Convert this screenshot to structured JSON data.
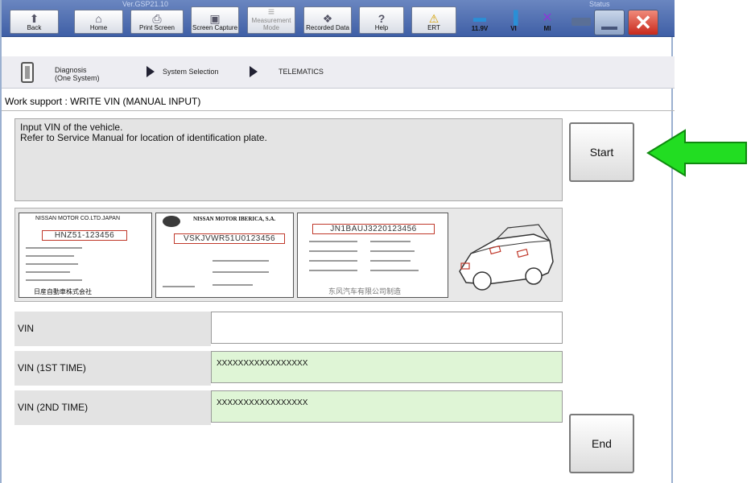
{
  "toolbar": {
    "version_left": "Ver.GSP21.10",
    "version_right": "Status",
    "buttons": [
      {
        "label": "Back",
        "icon": "back-arrow-icon",
        "glyph": "⬆"
      },
      {
        "label": "Home",
        "icon": "home-icon",
        "glyph": "⌂"
      },
      {
        "label": "Print Screen",
        "icon": "printer-icon",
        "glyph": "⎙"
      },
      {
        "label": "Screen Capture",
        "icon": "camera-icon",
        "glyph": "▣"
      },
      {
        "label": "Measurement Mode",
        "icon": "meter-icon",
        "glyph": "≡"
      },
      {
        "label": "Recorded Data",
        "icon": "recorded-data-icon",
        "glyph": "❖"
      },
      {
        "label": "Help",
        "icon": "help-icon",
        "glyph": "?"
      },
      {
        "label": "ERT",
        "icon": "warning-icon",
        "glyph": "⚠"
      }
    ],
    "status": [
      {
        "label": "11.9V",
        "icon": "car-battery-icon",
        "glyph": "🚗"
      },
      {
        "label": "VI",
        "icon": "signal-icon",
        "glyph": "📶"
      },
      {
        "label": "MI",
        "icon": "mi-cross-icon",
        "glyph": "✕"
      }
    ]
  },
  "breadcrumb": {
    "step1": "Diagnosis (One System)",
    "step2": "System Selection",
    "step3": "TELEMATICS"
  },
  "work_support_title": "Work support : WRITE VIN (MANUAL INPUT)",
  "message": {
    "line1": "Input VIN of the vehicle.",
    "line2": "Refer to Service Manual for location of identification plate."
  },
  "buttons": {
    "start": "Start",
    "end": "End"
  },
  "plates": {
    "plate1_maker": "NISSAN MOTOR CO.LTD.JAPAN",
    "plate1_vin": "HNZ51-123456",
    "plate1_footer": "日産自動車株式会社",
    "plate2_maker": "NISSAN MOTOR IBERICA, S.A.",
    "plate2_vin": "VSKJVWR51U0123456",
    "plate3_vin": "JN1BAUJ3220123456",
    "plate3_footer": "东风汽车有限公司制造"
  },
  "form": {
    "rows": [
      {
        "label": "VIN",
        "value": ""
      },
      {
        "label": "VIN (1ST TIME)",
        "value": "XXXXXXXXXXXXXXXXX"
      },
      {
        "label": "VIN (2ND TIME)",
        "value": "XXXXXXXXXXXXXXXXX"
      }
    ]
  },
  "colors": {
    "arrow": "#22dd22",
    "field_green": "#dff5d6",
    "close_red": "#d9362b"
  }
}
